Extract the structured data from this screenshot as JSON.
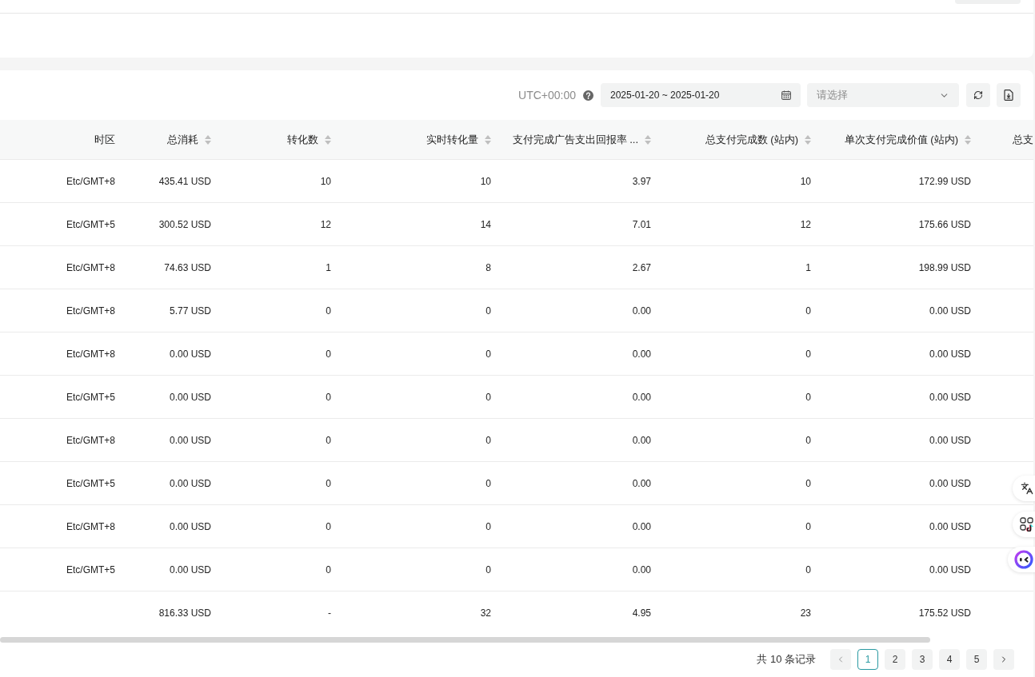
{
  "toolbar": {
    "timezone_label": "UTC+00:00",
    "date_range": {
      "value": "2025-01-20 ~ 2025-01-20"
    },
    "select": {
      "placeholder": "请选择"
    }
  },
  "table": {
    "columns": [
      {
        "label": "时区",
        "sortable": false
      },
      {
        "label": "总消耗",
        "sortable": true
      },
      {
        "label": "转化数",
        "sortable": true
      },
      {
        "label": "实时转化量",
        "sortable": true
      },
      {
        "label": "支付完成广告支出回报率 ...",
        "sortable": true
      },
      {
        "label": "总支付完成数 (站内)",
        "sortable": true
      },
      {
        "label": "单次支付完成价值 (站内)",
        "sortable": true
      },
      {
        "label": "总支",
        "sortable": false
      }
    ],
    "rows": [
      {
        "cells": [
          "Etc/GMT+8",
          "435.41 USD",
          "10",
          "10",
          "3.97",
          "10",
          "172.99 USD"
        ]
      },
      {
        "cells": [
          "Etc/GMT+5",
          "300.52 USD",
          "12",
          "14",
          "7.01",
          "12",
          "175.66 USD"
        ]
      },
      {
        "cells": [
          "Etc/GMT+8",
          "74.63 USD",
          "1",
          "8",
          "2.67",
          "1",
          "198.99 USD"
        ]
      },
      {
        "cells": [
          "Etc/GMT+8",
          "5.77 USD",
          "0",
          "0",
          "0.00",
          "0",
          "0.00 USD"
        ]
      },
      {
        "cells": [
          "Etc/GMT+8",
          "0.00 USD",
          "0",
          "0",
          "0.00",
          "0",
          "0.00 USD"
        ]
      },
      {
        "cells": [
          "Etc/GMT+5",
          "0.00 USD",
          "0",
          "0",
          "0.00",
          "0",
          "0.00 USD"
        ]
      },
      {
        "cells": [
          "Etc/GMT+8",
          "0.00 USD",
          "0",
          "0",
          "0.00",
          "0",
          "0.00 USD"
        ]
      },
      {
        "cells": [
          "Etc/GMT+5",
          "0.00 USD",
          "0",
          "0",
          "0.00",
          "0",
          "0.00 USD"
        ]
      },
      {
        "cells": [
          "Etc/GMT+8",
          "0.00 USD",
          "0",
          "0",
          "0.00",
          "0",
          "0.00 USD"
        ]
      },
      {
        "cells": [
          "Etc/GMT+5",
          "0.00 USD",
          "0",
          "0",
          "0.00",
          "0",
          "0.00 USD"
        ]
      }
    ],
    "summary": {
      "cells": [
        "816.33 USD",
        "-",
        "32",
        "4.95",
        "23",
        "175.52 USD"
      ]
    }
  },
  "pagination": {
    "total": "共 10 条记录",
    "pages": [
      {
        "label": "1",
        "selected": true
      },
      {
        "label": "2",
        "selected": false
      },
      {
        "label": "3",
        "selected": false
      },
      {
        "label": "4",
        "selected": false
      },
      {
        "label": "5",
        "selected": false
      }
    ]
  }
}
